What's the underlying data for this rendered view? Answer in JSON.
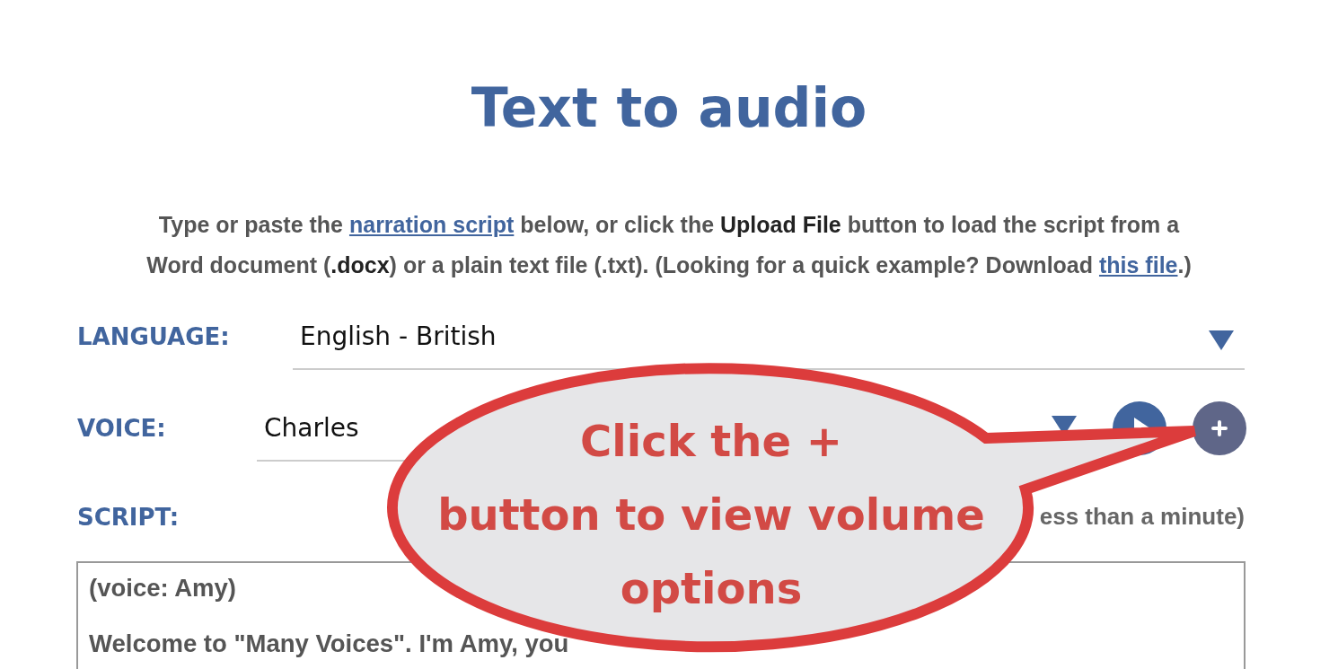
{
  "title": "Text to audio",
  "intro": [
    {
      "kind": "text",
      "text": "Type or paste the "
    },
    {
      "kind": "link",
      "text": "narration script"
    },
    {
      "kind": "text",
      "text": " below, or click the "
    },
    {
      "kind": "bold",
      "text": "Upload File"
    },
    {
      "kind": "text",
      "text": " button to load the script from a Word document ("
    },
    {
      "kind": "bold",
      "text": ".docx"
    },
    {
      "kind": "text",
      "text": ") or a plain text file (.txt). (Looking for a quick example? Download "
    },
    {
      "kind": "link",
      "text": "this file"
    },
    {
      "kind": "text",
      "text": ".)"
    }
  ],
  "language": {
    "label": "LANGUAGE:",
    "value": "English - British"
  },
  "voice": {
    "label": "VOICE:",
    "value": "Charles"
  },
  "script": {
    "label": "SCRIPT:",
    "note": "ess than a minute)",
    "lines": [
      "(voice: Amy)",
      "Welcome to \"Many Voices\". I'm Amy, you"
    ]
  },
  "callout": {
    "lines": [
      "Click the +",
      "button to view volume",
      "options"
    ]
  }
}
